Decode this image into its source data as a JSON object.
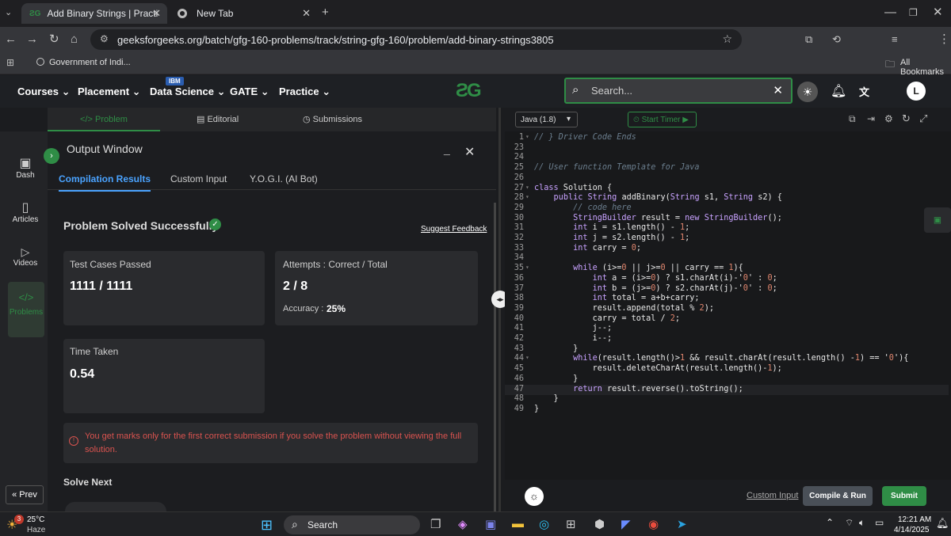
{
  "browser": {
    "tabs": [
      {
        "title": "Add Binary Strings | Practice | G",
        "favicon": "gfg-logo"
      },
      {
        "title": "New Tab",
        "favicon": "chrome-icon"
      }
    ],
    "url": "geeksforgeeks.org/batch/gfg-160-problems/track/string-gfg-160/problem/add-binary-strings3805",
    "bookmarks": [
      "Government of Indi..."
    ],
    "all_bookmarks": "All Bookmarks",
    "profile_initial": "L"
  },
  "nav": {
    "items": [
      "Courses",
      "Placement",
      "Data Science",
      "GATE",
      "Practice"
    ],
    "badge": "IBM",
    "search_placeholder": "Search...",
    "avatar": "L"
  },
  "problem_tabs": [
    "Problem",
    "Editorial",
    "Submissions"
  ],
  "sidebar": {
    "items": [
      "Dash",
      "Articles",
      "Videos",
      "Problems"
    ],
    "prev": "Prev"
  },
  "output": {
    "title": "Output Window",
    "tabs": [
      "Compilation Results",
      "Custom Input",
      "Y.O.G.I. (AI Bot)"
    ],
    "status": "Problem Solved Successfully",
    "suggest": "Suggest Feedback",
    "tests_label": "Test Cases Passed",
    "tests_value": "1111 / 1111",
    "attempts_label": "Attempts : Correct / Total",
    "attempts_value": "2 / 8",
    "accuracy_label": "Accuracy :",
    "accuracy_value": "25%",
    "time_label": "Time Taken",
    "time_value": "0.54",
    "notice": "You get marks only for the first correct submission if you solve the problem without viewing the full solution.",
    "solve_next": "Solve Next"
  },
  "editor": {
    "language": "Java (1.8)",
    "timer": "Start Timer",
    "custom_input": "Custom Input",
    "compile": "Compile & Run",
    "submit": "Submit",
    "lines": [
      {
        "n": "1",
        "t": "// } Driver Code Ends"
      },
      {
        "n": "23",
        "t": ""
      },
      {
        "n": "24",
        "t": ""
      },
      {
        "n": "25",
        "t": "// User function Template for Java"
      },
      {
        "n": "26",
        "t": ""
      },
      {
        "n": "27",
        "t": "class Solution {"
      },
      {
        "n": "28",
        "t": "    public String addBinary(String s1, String s2) {"
      },
      {
        "n": "29",
        "t": "        // code here"
      },
      {
        "n": "30",
        "t": "        StringBuilder result = new StringBuilder();"
      },
      {
        "n": "31",
        "t": "        int i = s1.length() - 1;"
      },
      {
        "n": "32",
        "t": "        int j = s2.length() - 1;"
      },
      {
        "n": "33",
        "t": "        int carry = 0;"
      },
      {
        "n": "34",
        "t": ""
      },
      {
        "n": "35",
        "t": "        while (i>=0 || j>=0 || carry == 1){"
      },
      {
        "n": "36",
        "t": "            int a = (i>=0) ? s1.charAt(i)-'0' : 0;"
      },
      {
        "n": "37",
        "t": "            int b = (j>=0) ? s2.charAt(j)-'0' : 0;"
      },
      {
        "n": "38",
        "t": "            int total = a+b+carry;"
      },
      {
        "n": "39",
        "t": "            result.append(total % 2);"
      },
      {
        "n": "40",
        "t": "            carry = total / 2;"
      },
      {
        "n": "41",
        "t": "            j--;"
      },
      {
        "n": "42",
        "t": "            i--;"
      },
      {
        "n": "43",
        "t": "        }"
      },
      {
        "n": "44",
        "t": "        while(result.length()>1 && result.charAt(result.length() -1) == '0'){"
      },
      {
        "n": "45",
        "t": "            result.deleteCharAt(result.length()-1);"
      },
      {
        "n": "46",
        "t": "        }"
      },
      {
        "n": "47",
        "t": "        return result.reverse().toString();"
      },
      {
        "n": "48",
        "t": "    }"
      },
      {
        "n": "49",
        "t": "}"
      }
    ]
  },
  "taskbar": {
    "weather_temp": "25°C",
    "weather_desc": "Haze",
    "weather_badge": "3",
    "search": "Search",
    "time": "12:21 AM",
    "date": "4/14/2025"
  },
  "colors": {
    "accent": "#2f8d46",
    "submit": "#2f8d46"
  }
}
